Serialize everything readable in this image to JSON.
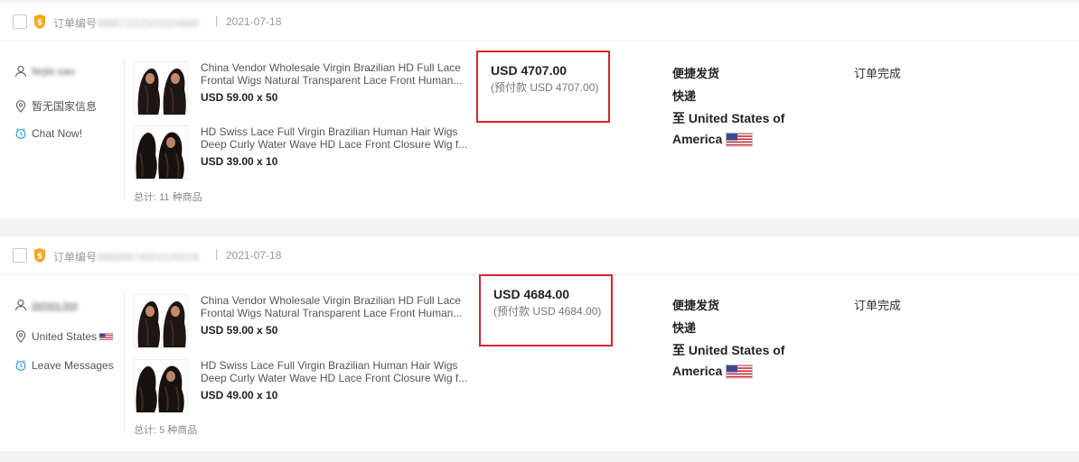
{
  "orders": [
    {
      "order_no_label": "订单编号",
      "order_no_value": "99867222501024680",
      "date": "2021-07-18",
      "buyer": {
        "name": "Itejie.sao",
        "location": "暂无国家信息",
        "show_flag": false,
        "action": "Chat Now!"
      },
      "products": [
        {
          "title": "China Vendor Wholesale Virgin Brazilian HD Full Lace Frontal Wigs Natural Transparent Lace Front Human...",
          "price": "USD 59.00 x 50",
          "thumb_icon": "wig-photo-icon"
        },
        {
          "title": "HD Swiss Lace Full Virgin Brazilian Human Hair Wigs Deep Curly Water Wave HD Lace Front Closure Wig f...",
          "price": "USD 39.00 x 10",
          "thumb_icon": "wig-photo-icon"
        }
      ],
      "total_items": "总计: 11 种商品",
      "amount": "USD 4707.00",
      "prepaid": "(预付款 USD 4707.00)",
      "shipping": {
        "method": "便捷发货",
        "carrier": "快递",
        "destination": "至 United States of America"
      },
      "status": "订单完成"
    },
    {
      "order_no_label": "订单编号",
      "order_no_value": "99689974601026024",
      "date": "2021-07-18",
      "buyer": {
        "name": "james.lee",
        "location": "United States",
        "show_flag": true,
        "action": "Leave Messages"
      },
      "products": [
        {
          "title": "China Vendor Wholesale Virgin Brazilian HD Full Lace Frontal Wigs Natural Transparent Lace Front Human...",
          "price": "USD 59.00 x 50",
          "thumb_icon": "wig-photo-icon"
        },
        {
          "title": "HD Swiss Lace Full Virgin Brazilian Human Hair Wigs Deep Curly Water Wave HD Lace Front Closure Wig f...",
          "price": "USD 49.00 x 10",
          "thumb_icon": "wig-photo-icon"
        }
      ],
      "total_items": "总计: 5 种商品",
      "amount": "USD 4684.00",
      "prepaid": "(预付款 USD 4684.00)",
      "shipping": {
        "method": "便捷发货",
        "carrier": "快递",
        "destination": "至 United States of America"
      },
      "status": "订单完成"
    }
  ],
  "colors": {
    "highlight_border": "#d9232e",
    "badge": "#f5a623",
    "link_icon": "#3a9ad9"
  }
}
